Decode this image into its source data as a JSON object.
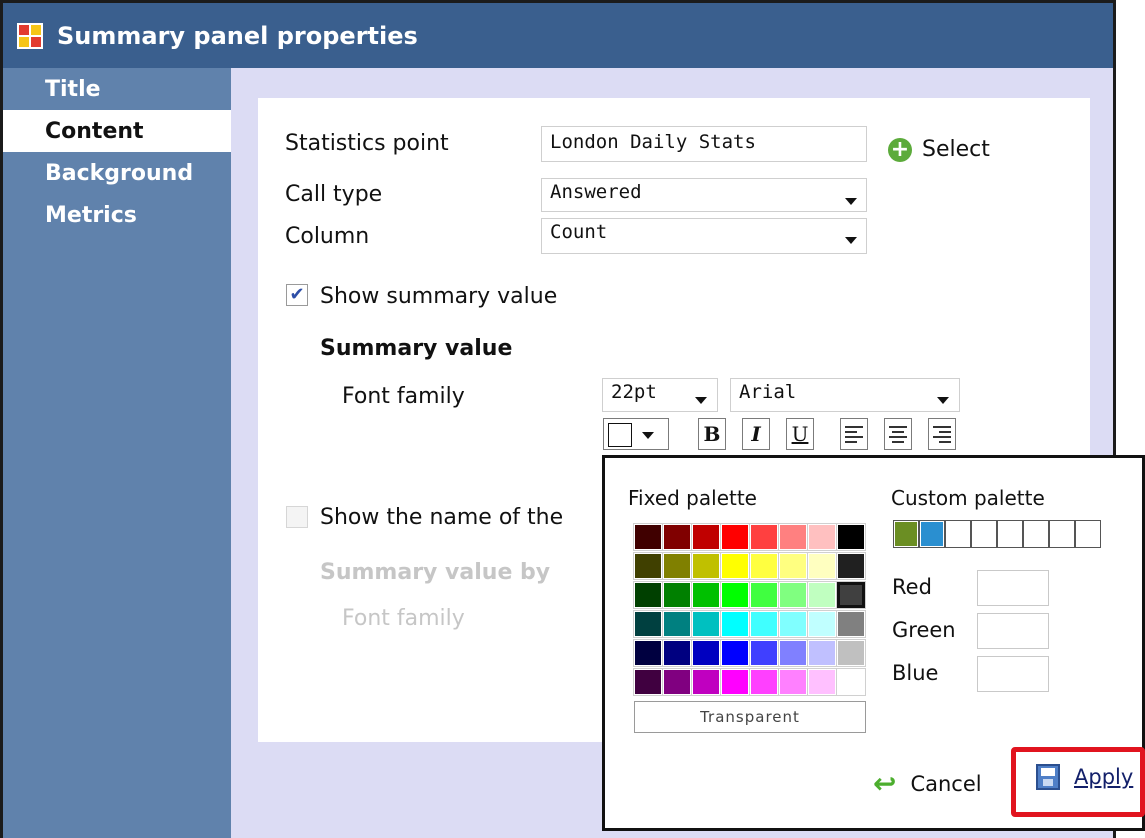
{
  "window": {
    "title": "Summary panel properties"
  },
  "sidebar": {
    "items": [
      {
        "label": "Title",
        "active": false
      },
      {
        "label": "Content",
        "active": true
      },
      {
        "label": "Background",
        "active": false
      },
      {
        "label": "Metrics",
        "active": false
      }
    ]
  },
  "form": {
    "statistics_point": {
      "label": "Statistics point",
      "value": "London Daily Stats",
      "select_label": "Select"
    },
    "call_type": {
      "label": "Call type",
      "value": "Answered"
    },
    "column": {
      "label": "Column",
      "value": "Count"
    },
    "show_summary_value": {
      "label": "Show summary value",
      "checked": true
    },
    "summary_value": {
      "heading": "Summary value",
      "font_family_label": "Font family",
      "font_size": "22pt",
      "font_name": "Arial",
      "bold": "B",
      "italic": "I",
      "underline": "U"
    },
    "show_name": {
      "label": "Show the name of the",
      "checked": false
    },
    "summary_value_by": {
      "heading": "Summary value by",
      "font_family_label": "Font family"
    }
  },
  "color_popup": {
    "fixed_palette_label": "Fixed palette",
    "custom_palette_label": "Custom palette",
    "transparent_label": "Transparent",
    "red_label": "Red",
    "green_label": "Green",
    "blue_label": "Blue",
    "cancel_label": "Cancel",
    "apply_label": "Apply",
    "fixed_colors": [
      [
        "#400000",
        "#800000",
        "#c00000",
        "#ff0000",
        "#ff4040",
        "#ff8080",
        "#ffc0c0",
        "#000000"
      ],
      [
        "#404000",
        "#808000",
        "#c0c000",
        "#ffff00",
        "#ffff40",
        "#ffff80",
        "#ffffc0",
        "#202020"
      ],
      [
        "#004000",
        "#008000",
        "#00c000",
        "#00ff00",
        "#40ff40",
        "#80ff80",
        "#c0ffc0",
        "#404040"
      ],
      [
        "#004040",
        "#008080",
        "#00c0c0",
        "#00ffff",
        "#40ffff",
        "#80ffff",
        "#c0ffff",
        "#808080"
      ],
      [
        "#000040",
        "#000080",
        "#0000c0",
        "#0000ff",
        "#4040ff",
        "#8080ff",
        "#c0c0ff",
        "#c0c0c0"
      ],
      [
        "#400040",
        "#800080",
        "#c000c0",
        "#ff00ff",
        "#ff40ff",
        "#ff80ff",
        "#ffc0ff",
        "#ffffff"
      ]
    ],
    "selected_fixed_color": "#404040",
    "custom_colors": [
      "#6b8e23",
      "#2a8fd0",
      "#ffffff",
      "#ffffff",
      "#ffffff",
      "#ffffff",
      "#ffffff",
      "#ffffff"
    ]
  }
}
